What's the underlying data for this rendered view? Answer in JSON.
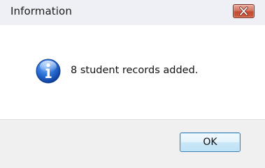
{
  "dialog": {
    "title": "Information",
    "message": "8 student records added.",
    "ok_label": "OK"
  },
  "icons": {
    "title_close": "close-icon",
    "message_icon": "info-icon"
  },
  "colors": {
    "close_button_red": "#c24b33",
    "ok_button_border": "#3c7fb1",
    "info_icon_blue": "#1f5fbf",
    "footer_gray": "#f0f0f0",
    "titlebar_bg": "#eef0f5"
  }
}
